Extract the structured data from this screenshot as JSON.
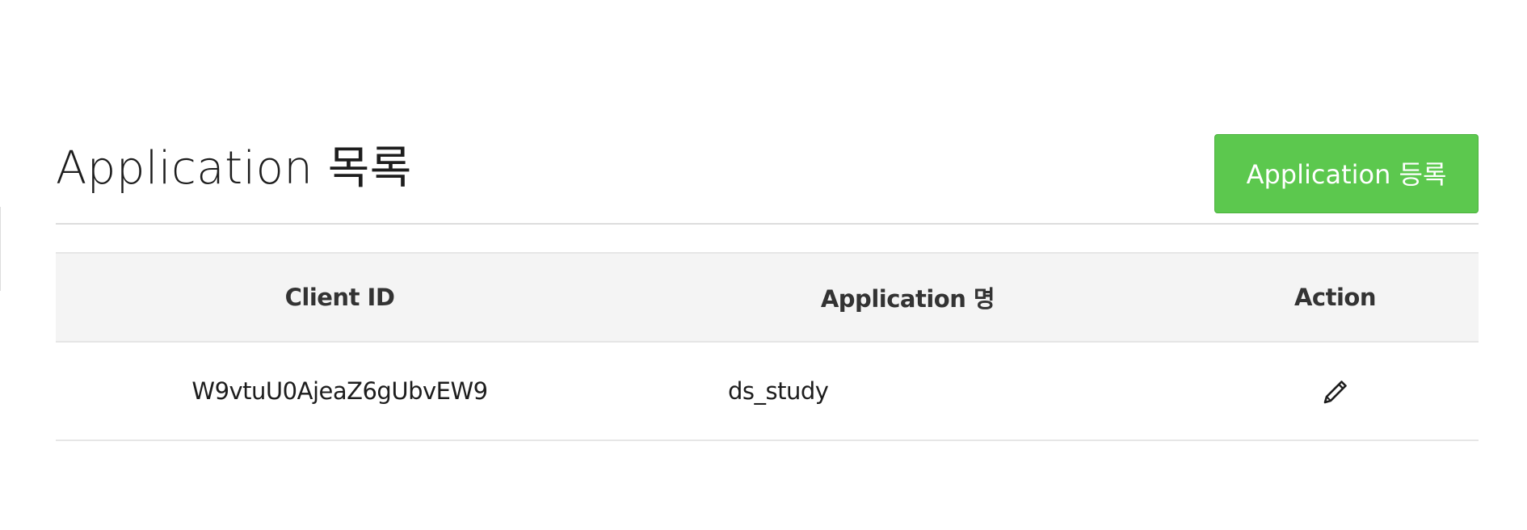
{
  "header": {
    "title": "Application 목록",
    "register_button_label": "Application 등록",
    "accent_color": "#5cc84e"
  },
  "table": {
    "columns": [
      "Client ID",
      "Application 명",
      "Action"
    ],
    "rows": [
      {
        "client_id": "W9vtuU0AjeaZ6gUbvEW9",
        "application_name": "ds_study",
        "action_icon": "pencil-edit-icon"
      }
    ]
  }
}
